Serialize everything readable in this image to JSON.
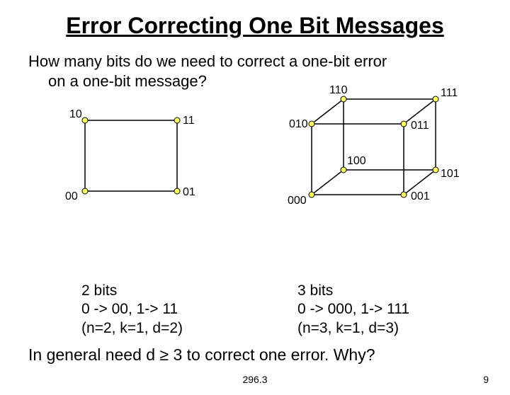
{
  "title": "Error Correcting One Bit Messages",
  "question_line1": "How many bits do we need to correct a one-bit error",
  "question_line2": "on a one-bit message?",
  "square": {
    "tl": "10",
    "tr": "11",
    "bl": "00",
    "br": "01"
  },
  "cube": {
    "back_tl": "110",
    "back_tr": "111",
    "front_tl": "010",
    "front_tr": "011",
    "back_bl": "100",
    "back_br": "101",
    "front_bl": "000",
    "front_br": "001"
  },
  "caption_left_l1": "2 bits",
  "caption_left_l2": "0 -> 00, 1-> 11",
  "caption_left_l3": "(n=2, k=1, d=2)",
  "caption_right_l1": "3 bits",
  "caption_right_l2": "0 -> 000, 1-> 111",
  "caption_right_l3": "(n=3, k=1, d=3)",
  "conclusion": "In general need d ≥ 3 to correct one error.  Why?",
  "footer_center": "296.3",
  "footer_right": "9"
}
